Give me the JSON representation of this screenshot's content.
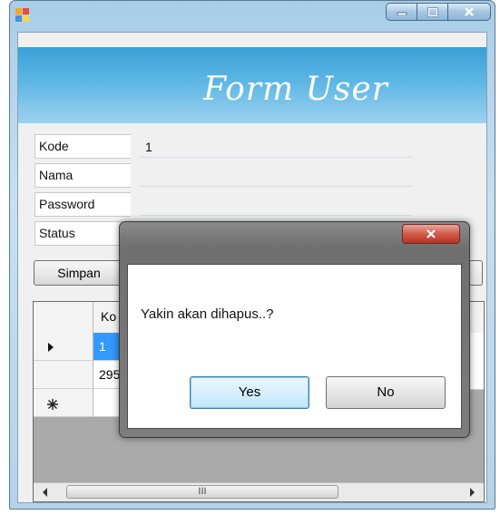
{
  "window": {
    "title": "",
    "icon": "app-icon"
  },
  "form": {
    "header_title": "Form User",
    "fields": [
      {
        "label": "Kode",
        "value": "1"
      },
      {
        "label": "Nama",
        "value": ""
      },
      {
        "label": "Password",
        "value": ""
      },
      {
        "label": "Status",
        "value": ""
      }
    ],
    "simpan_label": "Simpan"
  },
  "grid": {
    "header_col": "Ko",
    "rows": [
      {
        "marker": "current-row-arrow-icon",
        "value": "1"
      },
      {
        "marker": "",
        "value": "295"
      },
      {
        "marker": "new-row-asterisk-icon",
        "value": ""
      }
    ],
    "scroll_thumb": "III"
  },
  "dialog": {
    "message": "Yakin akan dihapus..?",
    "yes_label": "Yes",
    "no_label": "No"
  },
  "colors": {
    "banner": "#5cb6e4",
    "selection": "#3399ff",
    "close": "#d25a4a"
  }
}
